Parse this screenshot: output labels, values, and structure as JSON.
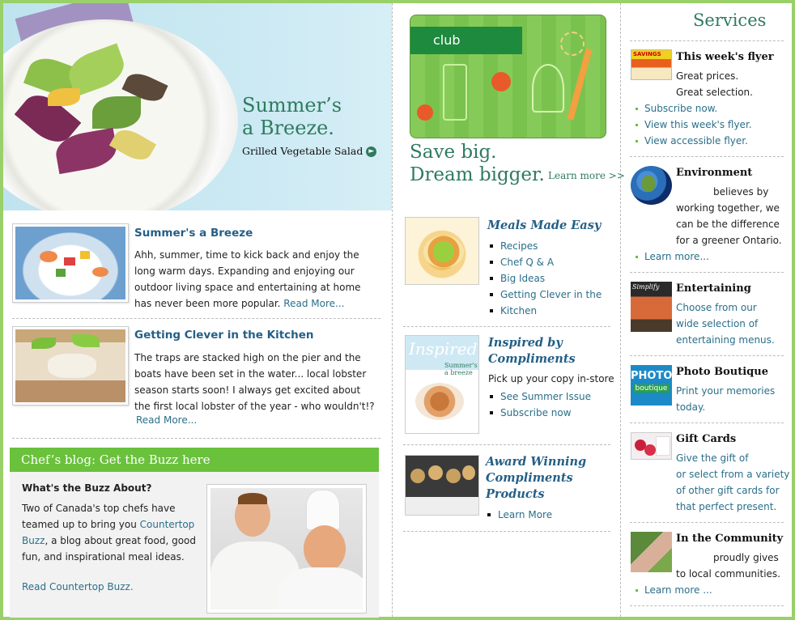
{
  "hero": {
    "title_line1": "Summer’s",
    "title_line2": "a Breeze.",
    "subtitle": "Grilled Vegetable Salad"
  },
  "articles": [
    {
      "title": "Summer's a Breeze",
      "lines": [
        "Ahh, summer, time to kick back and enjoy the",
        "long warm days. Expanding and enjoying our",
        "outdoor living space and entertaining at home"
      ],
      "last_line": "has never been more popular.",
      "read_more": "Read More..."
    },
    {
      "title": "Getting Clever in the Kitchen",
      "lines": [
        "The traps are stacked high on the pier and the",
        "boats have been set in the water... local lobster",
        "season starts soon! I always get excited about",
        "the first local lobster of the year - who wouldn't!?"
      ],
      "read_more": "Read More..."
    }
  ],
  "blog": {
    "bar": "Chef’s blog: Get the Buzz here",
    "heading": "What's the Buzz About?",
    "line1": "Two of Canada's top chefs have",
    "line2_pre": "teamed up to bring you",
    "line2_link": "Countertop",
    "line3_link": "Buzz",
    "line3_post": ", a blog about great food, good",
    "line4": "fun, and inspirational meal ideas.",
    "read_link": "Read Countertop Buzz."
  },
  "club": {
    "tag": "club",
    "save1": "Save big.",
    "save2": "Dream bigger.",
    "learn": "Learn more >>"
  },
  "meals": {
    "title": "Meals Made Easy",
    "items": [
      "Recipes",
      "Chef Q & A",
      "Big Ideas",
      "Getting Clever in the",
      "Kitchen"
    ]
  },
  "inspired": {
    "title1": "Inspired by",
    "title2": "Compliments",
    "text": "Pick up your copy in-store",
    "items": [
      "See Summer Issue",
      "Subscribe now"
    ],
    "cover_word": "Inspired",
    "cover_small": "Summer's a breeze"
  },
  "award": {
    "title1": "Award Winning",
    "title2": "Compliments",
    "title3": "Products",
    "item": "Learn More"
  },
  "services": {
    "title": "Services",
    "flyer": {
      "title": "This week's flyer",
      "line1": "Great prices.",
      "line2": "Great selection.",
      "links": [
        "Subscribe now.",
        "View this week's flyer.",
        "View accessible flyer."
      ],
      "thumb_text": "SAVINGS"
    },
    "environment": {
      "title": "Environment",
      "lines": [
        "believes by",
        "working together, we",
        "can be the difference",
        "for a greener Ontario."
      ],
      "link": "Learn more..."
    },
    "entertaining": {
      "title": "Entertaining",
      "lines": [
        "Choose from our",
        "wide selection of",
        "entertaining menus."
      ],
      "thumb_text": "Simplify"
    },
    "photo": {
      "title": "Photo Boutique",
      "lines": [
        "Print your memories",
        "today."
      ],
      "badge1": "PHOTO",
      "badge2": "boutique"
    },
    "gift": {
      "title": "Gift Cards",
      "lines": [
        "Give the gift of",
        "or select from a variety",
        "of other gift cards for",
        "that perfect present."
      ]
    },
    "community": {
      "title": "In the Community",
      "lines": [
        "proudly gives",
        "to local communities."
      ],
      "link": "Learn more ..."
    }
  }
}
